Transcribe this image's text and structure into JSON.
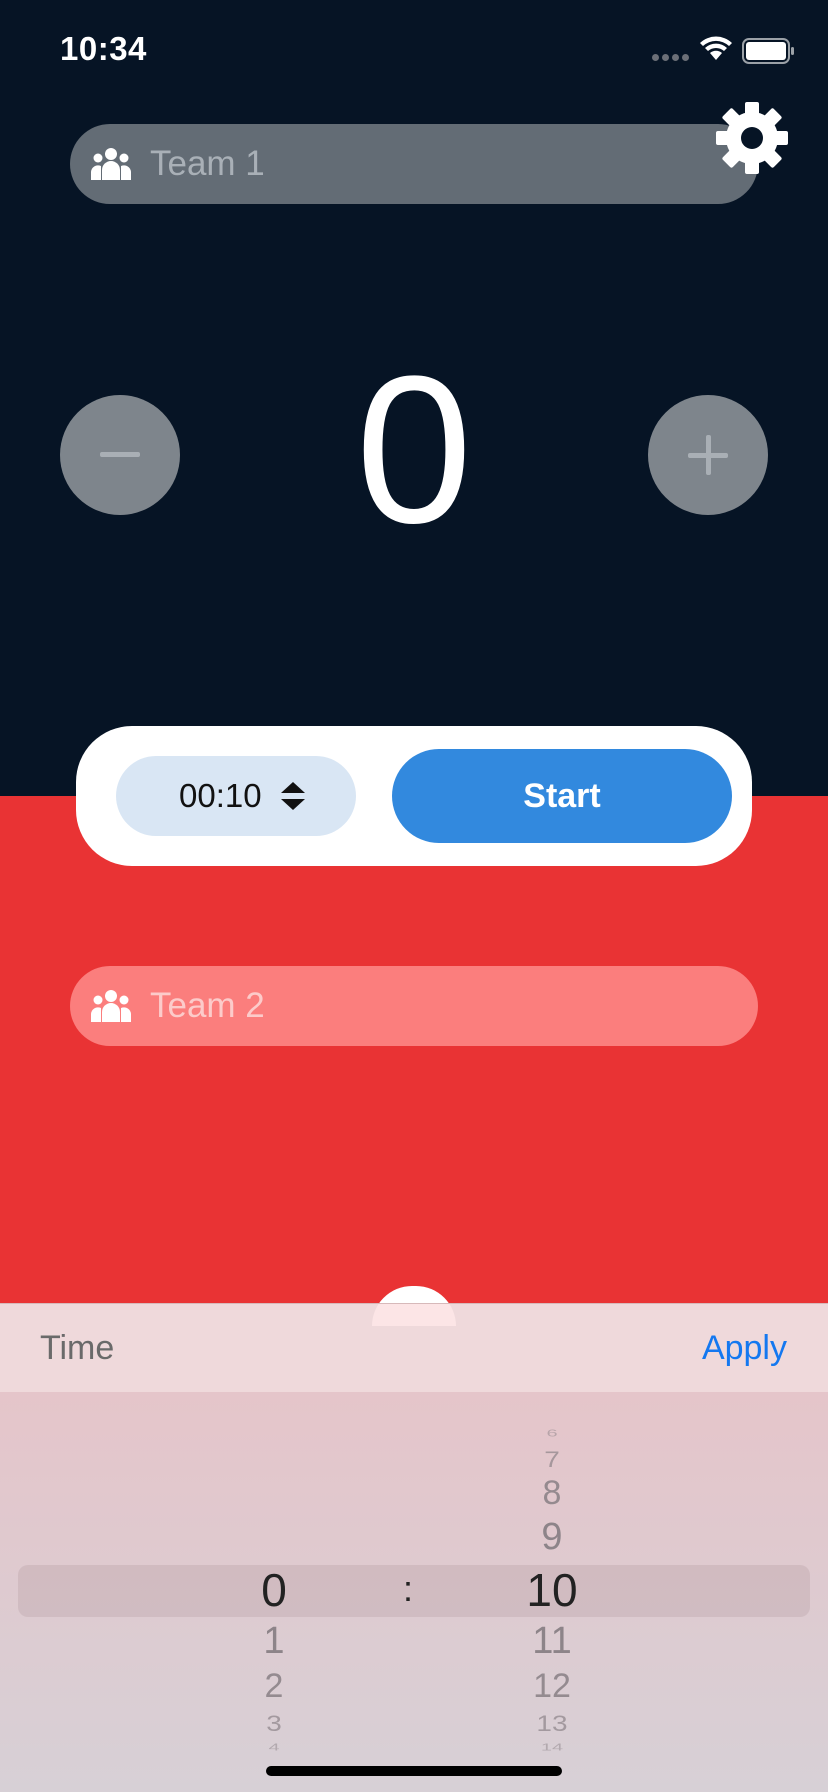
{
  "status_bar": {
    "time": "10:34"
  },
  "teams": {
    "team1_name": "Team 1",
    "team2_name": "Team 2"
  },
  "score": "0",
  "buttons": {
    "minus_label": "−",
    "plus_label": "+"
  },
  "timer": {
    "value": "00:10",
    "start_label": "Start"
  },
  "picker_toolbar": {
    "title": "Time",
    "apply_label": "Apply"
  },
  "picker": {
    "separator": ":",
    "hours": {
      "selected": "0",
      "below": [
        "1",
        "2",
        "3",
        "4"
      ]
    },
    "minutes": {
      "above": [
        "6",
        "7",
        "8",
        "9"
      ],
      "selected": "10",
      "below": [
        "11",
        "12",
        "13",
        "14"
      ]
    }
  },
  "colors": {
    "top_bg": "#061425",
    "bottom_bg": "#E93334",
    "accent": "#3289DE",
    "apply": "#1478F0"
  }
}
